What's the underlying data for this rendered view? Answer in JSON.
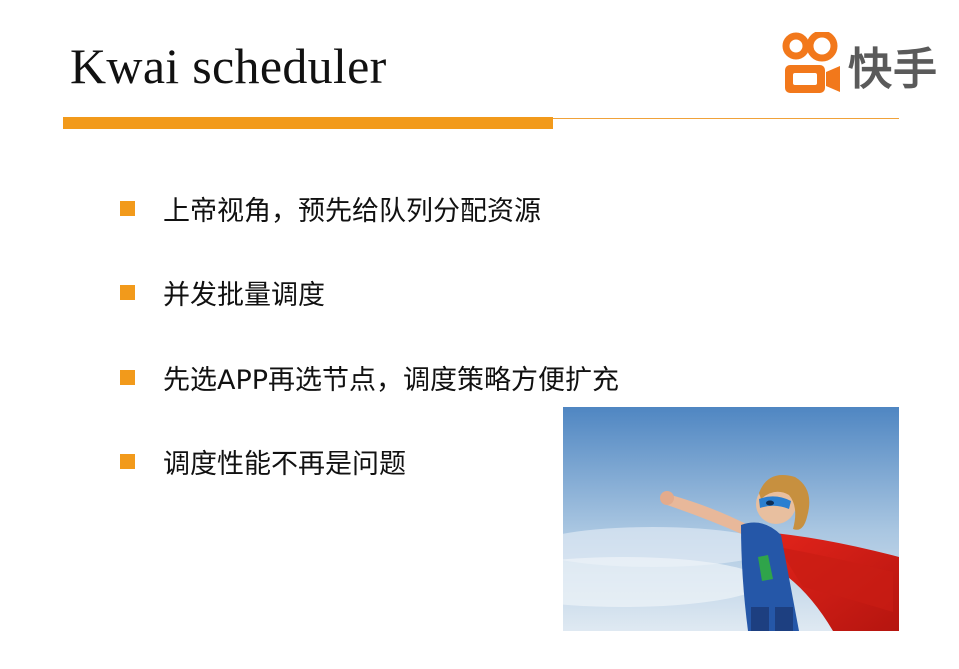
{
  "slide": {
    "title": "Kwai scheduler",
    "logo": {
      "text": "快手",
      "icon": "kwai-camera-logo-icon",
      "brand_color": "#f2781b"
    },
    "accent_color": "#f29a1b",
    "bullets": [
      {
        "text": "上帝视角，预先给队列分配资源"
      },
      {
        "text": "并发批量调度"
      },
      {
        "text": "先选APP再选节点，调度策略方便扩充"
      },
      {
        "text": "调度性能不再是问题"
      }
    ],
    "image": {
      "subject": "child-superhero-photo"
    }
  }
}
